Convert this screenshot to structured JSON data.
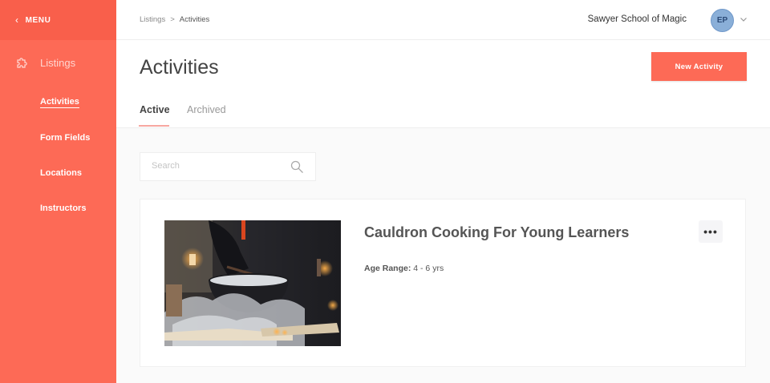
{
  "sidebar": {
    "menu_label": "MENU",
    "section_label": "Listings",
    "items": [
      {
        "label": "Activities"
      },
      {
        "label": "Form Fields"
      },
      {
        "label": "Locations"
      },
      {
        "label": "Instructors"
      }
    ]
  },
  "breadcrumb": {
    "parent": "Listings",
    "separator": ">",
    "current": "Activities"
  },
  "account": {
    "organization": "Sawyer School of Magic",
    "initials": "EP"
  },
  "page": {
    "title": "Activities",
    "new_button_label": "New Activity",
    "tabs": [
      {
        "label": "Active"
      },
      {
        "label": "Archived"
      }
    ]
  },
  "search": {
    "placeholder": "Search",
    "value": ""
  },
  "activities": [
    {
      "title": "Cauldron Cooking For Young Learners",
      "age_label": "Age Range:",
      "age_value": "4 - 6 yrs",
      "more_label": "•••"
    }
  ],
  "colors": {
    "accent": "#fd6a56",
    "sidebar_header": "#f95f4b",
    "avatar": "#8aafd8",
    "tab_underline": "#f7a7a0"
  }
}
